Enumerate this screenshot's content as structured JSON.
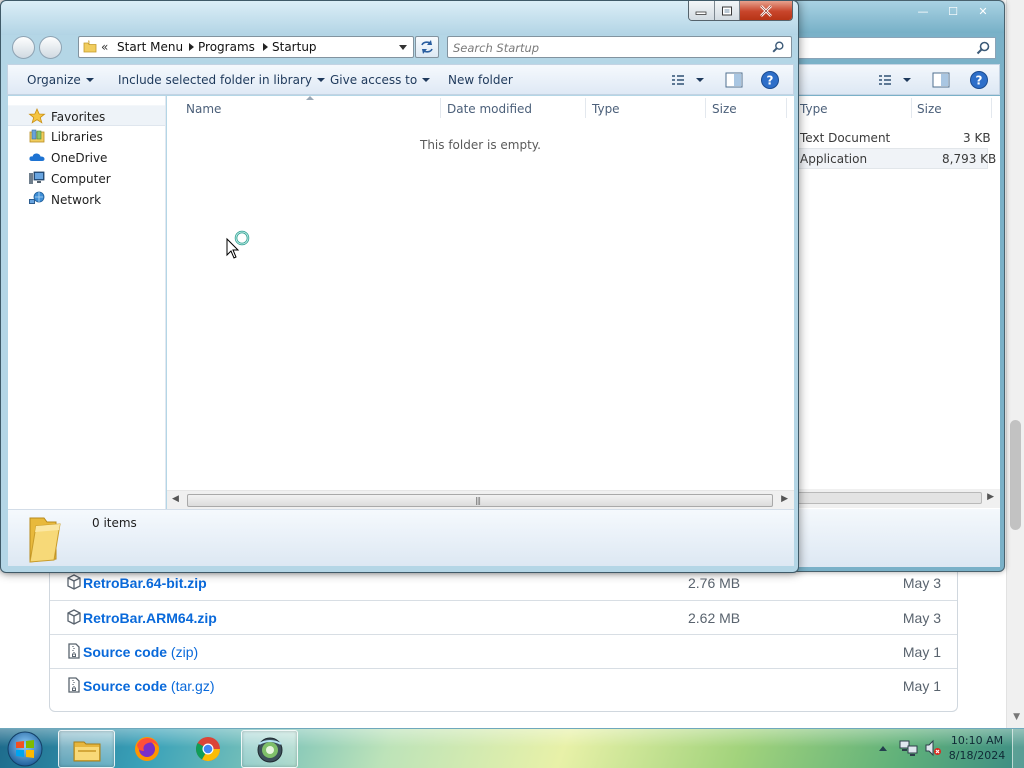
{
  "browser_page": {
    "assets": [
      {
        "icon": "package-icon",
        "name": "RetroBar.64-bit.zip",
        "name_suffix": "",
        "size": "2.76 MB",
        "date": "May 3"
      },
      {
        "icon": "package-icon",
        "name": "RetroBar.ARM64.zip",
        "name_suffix": "",
        "size": "2.62 MB",
        "date": "May 3"
      },
      {
        "icon": "file-zip-icon",
        "name": "Source code",
        "name_suffix": "(zip)",
        "size": "",
        "date": "May 1"
      },
      {
        "icon": "file-zip-icon",
        "name": "Source code",
        "name_suffix": "(tar.gz)",
        "size": "",
        "date": "May 1"
      }
    ]
  },
  "back_window": {
    "columns": {
      "type": "Type",
      "size": "Size"
    },
    "rows": [
      {
        "type": "Text Document",
        "size": "3 KB"
      },
      {
        "type": "Application",
        "size": "8,793 KB"
      }
    ]
  },
  "explorer": {
    "address": {
      "overflow": "«",
      "crumbs": [
        "Start Menu",
        "Programs",
        "Startup"
      ]
    },
    "search": {
      "placeholder": "Search Startup"
    },
    "toolbar": {
      "organize": "Organize",
      "include_library": "Include selected folder in library",
      "give_access": "Give access to",
      "new_folder": "New folder"
    },
    "nav": {
      "items": [
        {
          "label": "Favorites",
          "icon": "star-icon"
        },
        {
          "label": "Libraries",
          "icon": "libraries-icon"
        },
        {
          "label": "OneDrive",
          "icon": "onedrive-cloud-icon"
        },
        {
          "label": "Computer",
          "icon": "computer-icon"
        },
        {
          "label": "Network",
          "icon": "network-icon"
        }
      ]
    },
    "columns": {
      "name": "Name",
      "date_modified": "Date modified",
      "type": "Type",
      "size": "Size"
    },
    "empty_message": "This folder is empty.",
    "status": {
      "items_count": "0 items"
    }
  },
  "taskbar": {
    "apps": [
      "explorer-icon",
      "firefox-icon",
      "chrome-icon",
      "retrobar-icon"
    ],
    "clock": {
      "time": "10:10 AM",
      "date": "8/18/2024"
    }
  },
  "colors": {
    "link_blue": "#0969da",
    "taskbar_accent": "#a2d37c",
    "close_red": "#c8452b"
  }
}
